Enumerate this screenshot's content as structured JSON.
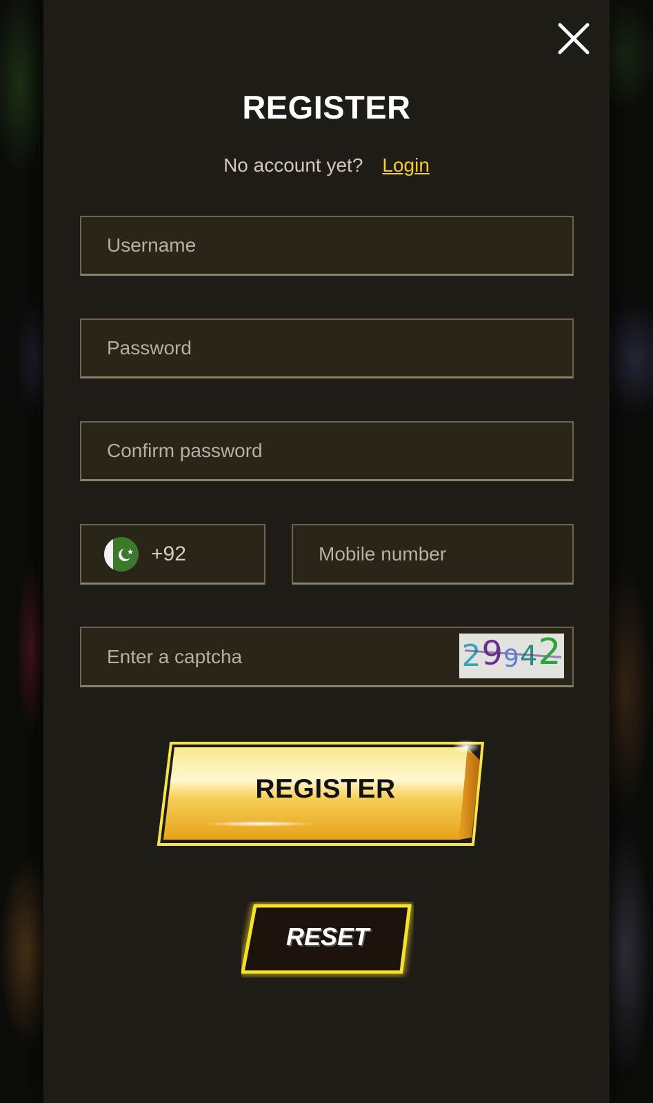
{
  "modal": {
    "title": "REGISTER",
    "subline_text": "No account yet?",
    "login_link": "Login"
  },
  "form": {
    "username_placeholder": "Username",
    "password_placeholder": "Password",
    "confirm_password_placeholder": "Confirm password",
    "country_code": "+92",
    "country_flag": "pakistan-flag-icon",
    "mobile_placeholder": "Mobile number",
    "captcha_placeholder": "Enter a captcha",
    "captcha_digits": [
      "2",
      "9",
      "9",
      "4",
      "2"
    ]
  },
  "buttons": {
    "register_label": "REGISTER",
    "reset_label": "RESET"
  },
  "colors": {
    "panel": "#1f1b16",
    "field_bg": "#2a2519",
    "accent_yellow": "#f2cf23",
    "text": "#ffffff"
  }
}
